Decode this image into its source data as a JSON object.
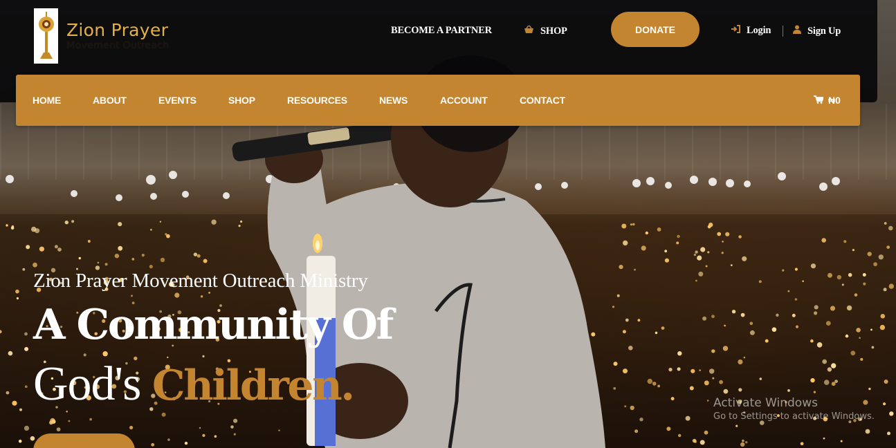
{
  "brand": {
    "title": "Zion Prayer",
    "subtitle": "Movement Outreach",
    "emblem_icon": "monstrance-icon"
  },
  "topbar": {
    "partner_label": "BECOME A PARTNER",
    "shop_label": "SHOP",
    "shop_icon": "basket-icon",
    "donate_label": "DONATE",
    "login_label": "Login",
    "login_icon": "sign-in-icon",
    "signup_label": "Sign Up",
    "signup_icon": "user-icon"
  },
  "nav": {
    "items": [
      {
        "label": "HOME"
      },
      {
        "label": "ABOUT"
      },
      {
        "label": "EVENTS"
      },
      {
        "label": "SHOP"
      },
      {
        "label": "RESOURCES"
      },
      {
        "label": "NEWS"
      },
      {
        "label": "ACCOUNT"
      },
      {
        "label": "CONTACT"
      }
    ],
    "cart_icon": "cart-icon",
    "cart_total": "₦0"
  },
  "hero": {
    "subtitle": "Zion Prayer Movement Outreach Ministry",
    "headline_line1": "A Community Of",
    "headline_line2_plain": "God's ",
    "headline_line2_accent": "Children."
  },
  "watermark": {
    "title": "Activate Windows",
    "subtitle": "Go to Settings to activate Windows."
  },
  "colors": {
    "accent": "#c48530",
    "logo_gold": "#e3b04b",
    "topbar_bg": "#08080a",
    "text": "#ffffff"
  }
}
